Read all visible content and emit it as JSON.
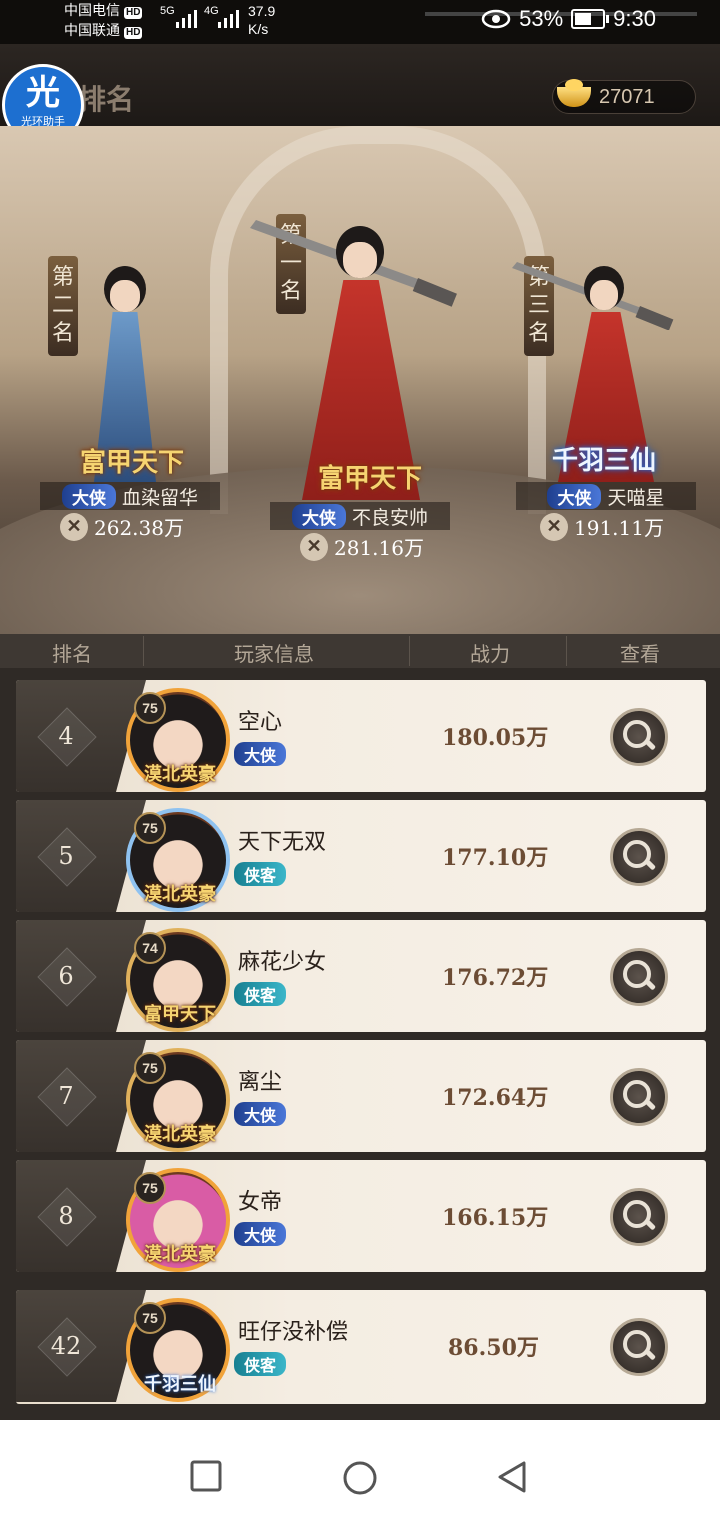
{
  "status_bar": {
    "carrier1": "中国电信",
    "carrier2": "中国联通",
    "hd": "HD",
    "net1": "5G",
    "net2": "4G",
    "speed_value": "37.9",
    "speed_unit": "K/s",
    "battery": "53%",
    "time": "9:30"
  },
  "helper_logo": {
    "glyph": "光",
    "label": "光环助手"
  },
  "page": {
    "title": "排名",
    "gold": "27071"
  },
  "podium": [
    {
      "rank_label": "第一名",
      "name": "不良安帅",
      "title": "大侠",
      "guild": "富甲天下",
      "power": "281.16万"
    },
    {
      "rank_label": "第二名",
      "name": "血染留华",
      "title": "大侠",
      "guild": "富甲天下",
      "power": "262.38万"
    },
    {
      "rank_label": "第三名",
      "name": "天喵星",
      "title": "大侠",
      "guild": "千羽三仙",
      "power": "191.11万"
    }
  ],
  "table_header": {
    "rank": "排名",
    "player": "玩家信息",
    "power": "战力",
    "view": "查看"
  },
  "rows": [
    {
      "rank": "4",
      "level": "75",
      "name": "空心",
      "title": "大侠",
      "guild": "漠北英豪",
      "power": "180.05万"
    },
    {
      "rank": "5",
      "level": "75",
      "name": "天下无双",
      "title": "侠客",
      "guild": "漠北英豪",
      "power": "177.10万"
    },
    {
      "rank": "6",
      "level": "74",
      "name": "麻花少女",
      "title": "侠客",
      "guild": "富甲天下",
      "power": "176.72万"
    },
    {
      "rank": "7",
      "level": "75",
      "name": "离尘",
      "title": "大侠",
      "guild": "漠北英豪",
      "power": "172.64万"
    },
    {
      "rank": "8",
      "level": "75",
      "name": "女帝",
      "title": "大侠",
      "guild": "漠北英豪",
      "power": "166.15万"
    }
  ],
  "my_row": {
    "rank": "42",
    "level": "75",
    "name": "旺仔没补偿",
    "title": "侠客",
    "guild": "千羽三仙",
    "power": "86.50万"
  }
}
